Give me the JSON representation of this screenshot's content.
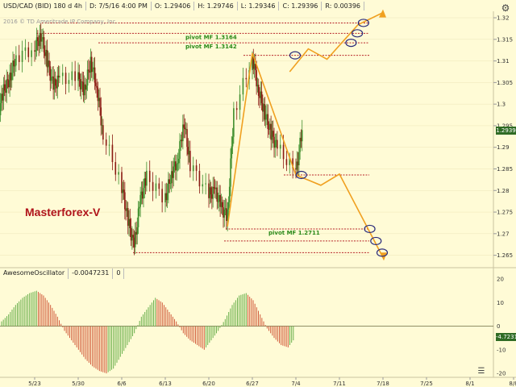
{
  "header": {
    "symbol": "USD/CAD (BID) 180 d 4h",
    "date": "D: 7/5/16 4:00 PM",
    "open": "O: 1.29406",
    "high": "H: 1.29746",
    "low": "L: 1.29346",
    "close": "C: 1.29396",
    "range": "R: 0.00396",
    "watermark": "2016 © TD Ameritrade IP Company, Inc."
  },
  "brand": "Masterforex-V",
  "oscillator": {
    "name": "AwesomeOscillator",
    "value": "-0.0047231",
    "extra": "0"
  },
  "colors": {
    "background": "#fffbd6",
    "up_candle": "#3f8f2e",
    "down_candle": "#8a1a12",
    "pivot_line": "#b8262a",
    "forecast": "#f0a020",
    "circle": "#2a2a7a",
    "pivot_text": "#2a8a1a",
    "osc_up": "#6ab04c",
    "osc_down": "#d15a3a",
    "badge_price": "#2f6b24",
    "badge_osc": "#2f6b24"
  },
  "icons": {
    "settings": "gear-icon",
    "menu": "menu-icon"
  },
  "chart_data": [
    {
      "type": "candlestick",
      "title": "USD/CAD (BID) 180 d 4h",
      "x_ticks": [
        "5/23",
        "5/30",
        "6/6",
        "6/13",
        "6/20",
        "6/27",
        "7/4",
        "7/11",
        "7/18",
        "7/25",
        "8/1",
        "8/8"
      ],
      "y_ticks": [
        1.32,
        1.315,
        1.31,
        1.305,
        1.3,
        1.295,
        1.29,
        1.285,
        1.28,
        1.275,
        1.27,
        1.265
      ],
      "ylim": [
        1.2625,
        1.3215
      ],
      "price_badge": "1.2939",
      "daily_close": [
        {
          "date": "5/16",
          "value": 1.292
        },
        {
          "date": "5/17",
          "value": 1.297
        },
        {
          "date": "5/18",
          "value": 1.303
        },
        {
          "date": "5/19",
          "value": 1.306
        },
        {
          "date": "5/20",
          "value": 1.311
        },
        {
          "date": "5/23",
          "value": 1.313
        },
        {
          "date": "5/24",
          "value": 1.316
        },
        {
          "date": "5/25",
          "value": 1.31
        },
        {
          "date": "5/26",
          "value": 1.304
        },
        {
          "date": "5/27",
          "value": 1.306
        },
        {
          "date": "5/30",
          "value": 1.306
        },
        {
          "date": "5/31",
          "value": 1.303
        },
        {
          "date": "6/1",
          "value": 1.31
        },
        {
          "date": "6/2",
          "value": 1.304
        },
        {
          "date": "6/3",
          "value": 1.293
        },
        {
          "date": "6/6",
          "value": 1.281
        },
        {
          "date": "6/7",
          "value": 1.273
        },
        {
          "date": "6/8",
          "value": 1.267
        },
        {
          "date": "6/9",
          "value": 1.278
        },
        {
          "date": "6/10",
          "value": 1.283
        },
        {
          "date": "6/13",
          "value": 1.278
        },
        {
          "date": "6/14",
          "value": 1.284
        },
        {
          "date": "6/15",
          "value": 1.287
        },
        {
          "date": "6/16",
          "value": 1.296
        },
        {
          "date": "6/17",
          "value": 1.286
        },
        {
          "date": "6/20",
          "value": 1.279
        },
        {
          "date": "6/21",
          "value": 1.28
        },
        {
          "date": "6/22",
          "value": 1.276
        },
        {
          "date": "6/23",
          "value": 1.274
        },
        {
          "date": "6/24",
          "value": 1.298
        },
        {
          "date": "6/27",
          "value": 1.311
        },
        {
          "date": "6/28",
          "value": 1.303
        },
        {
          "date": "6/29",
          "value": 1.298
        },
        {
          "date": "6/30",
          "value": 1.293
        },
        {
          "date": "7/1",
          "value": 1.29
        },
        {
          "date": "7/4",
          "value": 1.284
        },
        {
          "date": "7/5",
          "value": 1.294
        }
      ],
      "pivot_lines": [
        {
          "price": 1.3188,
          "label": ""
        },
        {
          "price": 1.3164,
          "label": "pivot MF 1.3164"
        },
        {
          "price": 1.3142,
          "label": "pivot MF 1.3142"
        },
        {
          "price": 1.3113,
          "label": ""
        },
        {
          "price": 1.2836,
          "label": ""
        },
        {
          "price": 1.2711,
          "label": "pivot MF 1.2711"
        },
        {
          "price": 1.2683,
          "label": ""
        },
        {
          "price": 1.2656,
          "label": ""
        }
      ],
      "forecast_path": [
        {
          "date": "7/4",
          "value": 1.2836
        },
        {
          "date": "7/8",
          "value": 1.2812
        },
        {
          "date": "7/11",
          "value": 1.2838
        },
        {
          "date": "7/18",
          "value": 1.2645
        }
      ],
      "forecast_up_path": [
        {
          "date": "7/3",
          "value": 1.3075
        },
        {
          "date": "7/6",
          "value": 1.3128
        },
        {
          "date": "7/9",
          "value": 1.3104
        },
        {
          "date": "7/12",
          "value": 1.3152
        },
        {
          "date": "7/14",
          "value": 1.3184
        },
        {
          "date": "7/18",
          "value": 1.3212
        }
      ]
    },
    {
      "type": "bar",
      "title": "AwesomeOscillator",
      "y_ticks": [
        20,
        10,
        0,
        -10,
        -20
      ],
      "ylim": [
        -21,
        20
      ],
      "value_badge": "-4.7231",
      "values": [
        2,
        5,
        9,
        12,
        14,
        15,
        13,
        9,
        4,
        -2,
        -6,
        -10,
        -14,
        -17,
        -19,
        -20,
        -18,
        -13,
        -8,
        -3,
        4,
        8,
        12,
        10,
        6,
        2,
        -3,
        -6,
        -8,
        -10,
        -6,
        -2,
        3,
        9,
        13,
        14,
        11,
        5,
        -1,
        -5,
        -8,
        -9,
        -5
      ]
    }
  ]
}
